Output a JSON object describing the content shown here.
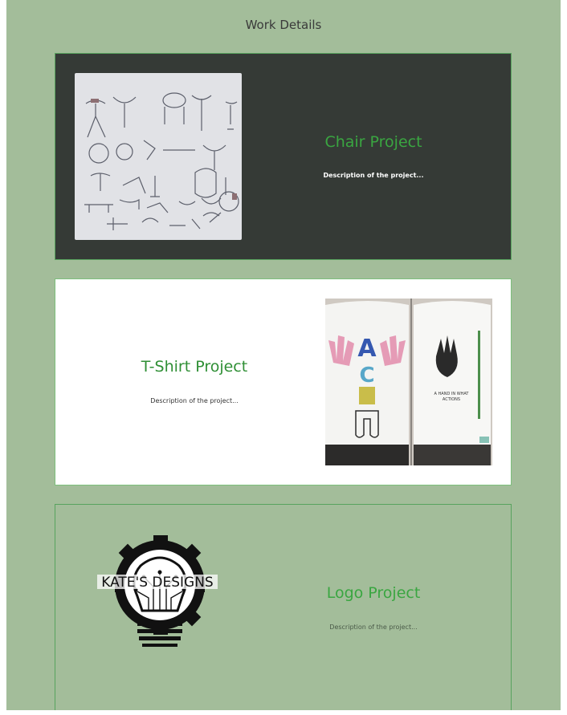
{
  "page": {
    "title": "Work Details",
    "background_color": "#a3bd9a"
  },
  "projects": [
    {
      "title": "Chair Project",
      "description": "Description of the project...",
      "image_icon": "chair-sketch-image",
      "card_color": "#353a36",
      "title_color": "#3aa641"
    },
    {
      "title": "T-Shirt Project",
      "description": "Description of the project...",
      "image_icon": "tshirt-photo-image",
      "card_color": "#ffffff",
      "title_color": "#2f8f35"
    },
    {
      "title": "Logo Project",
      "description": "Description of the project...",
      "image_icon": "lightbulb-gear-logo",
      "card_color": "#a3bd9a",
      "title_color": "#3aa641",
      "logo_text": "KATE'S DESIGNS"
    }
  ]
}
